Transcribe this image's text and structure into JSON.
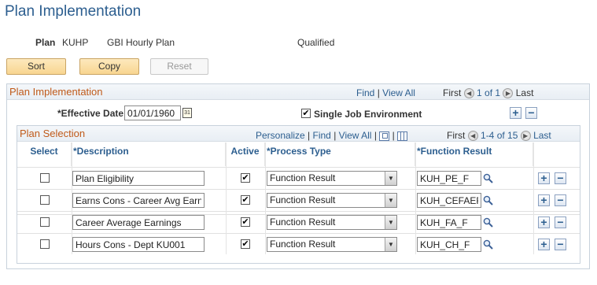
{
  "page": {
    "title": "Plan Implementation"
  },
  "plan": {
    "label": "Plan",
    "code": "KUHP",
    "description": "GBI Hourly Plan",
    "status": "Qualified"
  },
  "buttons": {
    "sort": "Sort",
    "copy": "Copy",
    "reset": "Reset"
  },
  "implementation": {
    "title": "Plan Implementation",
    "find": "Find",
    "separator": "|",
    "view_all": "View All",
    "first": "First",
    "counter": "1 of 1",
    "last": "Last",
    "effective_date_label": "*Effective Date",
    "effective_date_value": "01/01/1960",
    "single_job_label": "Single Job Environment",
    "single_job_checked": true
  },
  "selection": {
    "title": "Plan Selection",
    "personalize": "Personalize",
    "find": "Find",
    "view_all": "View All",
    "first": "First",
    "counter": "1-4 of 15",
    "last": "Last",
    "columns": {
      "select": "Select",
      "description": "*Description",
      "active": "Active",
      "process_type": "*Process Type",
      "function_result": "*Function Result"
    },
    "rows": [
      {
        "description": "Plan Eligibility",
        "active": true,
        "process_type": "Function Result",
        "function_result": "KUH_PE_F"
      },
      {
        "description": "Earns Cons - Career Avg Earn",
        "active": true,
        "process_type": "Function Result",
        "function_result": "KUH_CEFAEF"
      },
      {
        "description": "Career Average Earnings",
        "active": true,
        "process_type": "Function Result",
        "function_result": "KUH_FA_F"
      },
      {
        "description": "Hours Cons - Dept KU001",
        "active": true,
        "process_type": "Function Result",
        "function_result": "KUH_CH_F"
      }
    ]
  },
  "colors": {
    "title_blue": "#2c5e8f",
    "section_orange": "#c05a1a",
    "button_gold": "#f8d590"
  },
  "icons": {
    "calendar": "calendar-icon",
    "lookup": "magnifier-icon",
    "add": "plus",
    "delete": "minus",
    "prev": "left-arrow",
    "next": "right-arrow"
  },
  "glyphs": {
    "add": "+",
    "delete": "−",
    "prev": "◀",
    "next": "▶",
    "check": "✔",
    "dropdown": "▼",
    "calendar": "31"
  }
}
